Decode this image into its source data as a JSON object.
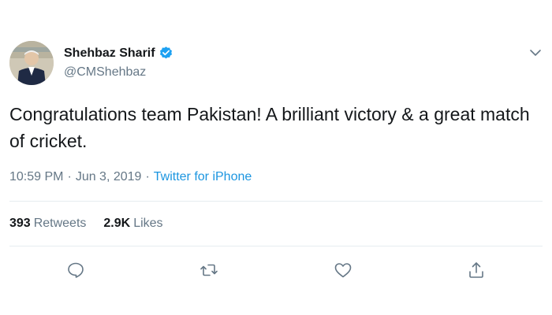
{
  "author": {
    "display_name": "Shehbaz Sharif",
    "handle": "@CMShehbaz",
    "verified": true
  },
  "tweet": {
    "text": "Congratulations team Pakistan! A brilliant victory & a great match of cricket.",
    "time": "10:59 PM",
    "date": "Jun 3, 2019",
    "source": "Twitter for iPhone"
  },
  "stats": {
    "retweets_count": "393",
    "retweets_label": "Retweets",
    "likes_count": "2.9K",
    "likes_label": "Likes"
  },
  "colors": {
    "link": "#1b95e0",
    "muted": "#657786",
    "verified": "#1da1f2"
  },
  "icons": {
    "reply": "reply-icon",
    "retweet": "retweet-icon",
    "like": "heart-icon",
    "share": "share-icon",
    "more": "chevron-down-icon"
  }
}
